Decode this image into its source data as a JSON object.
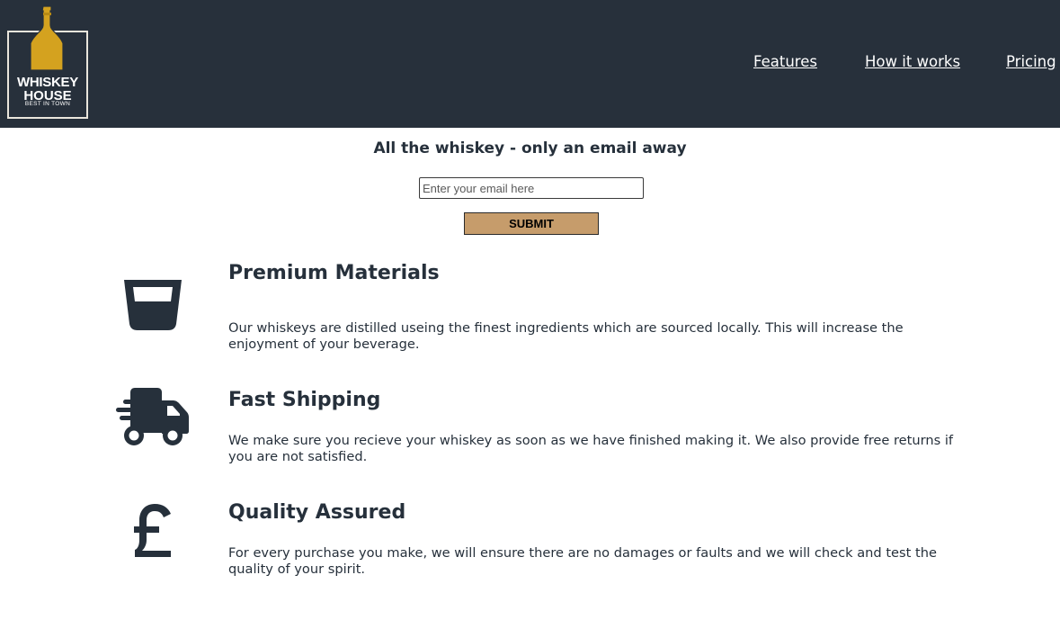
{
  "colors": {
    "header_bg": "#27303b",
    "text": "#26303b",
    "accent": "#c69c6b",
    "logo_gold": "#d4a21f"
  },
  "logo": {
    "line1": "WHISKEY",
    "line2": "HOUSE",
    "line3": "BEST IN TOWN"
  },
  "nav": {
    "items": [
      "Features",
      "How it works",
      "Pricing"
    ]
  },
  "hero": {
    "title": "All the whiskey - only an email away",
    "email_placeholder": "Enter your email here",
    "submit_label": "SUBMIT"
  },
  "features": [
    {
      "icon": "whiskey-glass-icon",
      "title": "Premium Materials",
      "text": "Our whiskeys are distilled useing the finest ingredients which are sourced locally. This will increase the enjoyment of your beverage."
    },
    {
      "icon": "shipping-truck-icon",
      "title": "Fast Shipping",
      "text": "We make sure you recieve your whiskey as soon as we have finished making it. We also provide free returns if you are not satisfied."
    },
    {
      "icon": "pound-sign-icon",
      "title": "Quality Assured",
      "text": "For every purchase you make, we will ensure there are no damages or faults and we will check and test the quality of your spirit."
    }
  ]
}
